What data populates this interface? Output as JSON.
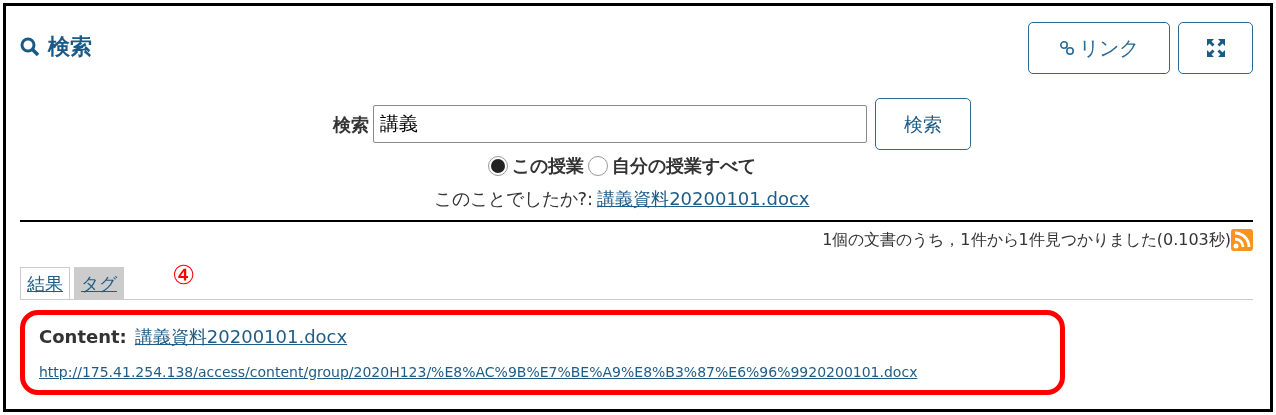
{
  "title": "検索",
  "toolbar": [
    {
      "kind": "link",
      "label": "リンク"
    },
    {
      "kind": "expand"
    }
  ],
  "search": {
    "label": "検索",
    "value": "講義",
    "button": "検索"
  },
  "scope": [
    {
      "label": "この授業",
      "selected": true
    },
    {
      "label": "自分の授業すべて",
      "selected": false
    }
  ],
  "suggestion": {
    "prefix": "このことでしたか?:",
    "link": "講義資料20200101.docx"
  },
  "summary": "1個の文書のうち，1件から1件見つかりました(0.103秒)",
  "tabs": [
    {
      "label": "結果",
      "selected": true
    },
    {
      "label": "タグ",
      "selected": false
    }
  ],
  "annotation": "④",
  "results": [
    {
      "label": "Content:",
      "title": "講義資料20200101.docx",
      "url": "http://175.41.254.138/access/content/group/2020H123/%E8%AC%9B%E7%BE%A9%E8%B3%87%E6%96%9920200101.docx"
    }
  ]
}
